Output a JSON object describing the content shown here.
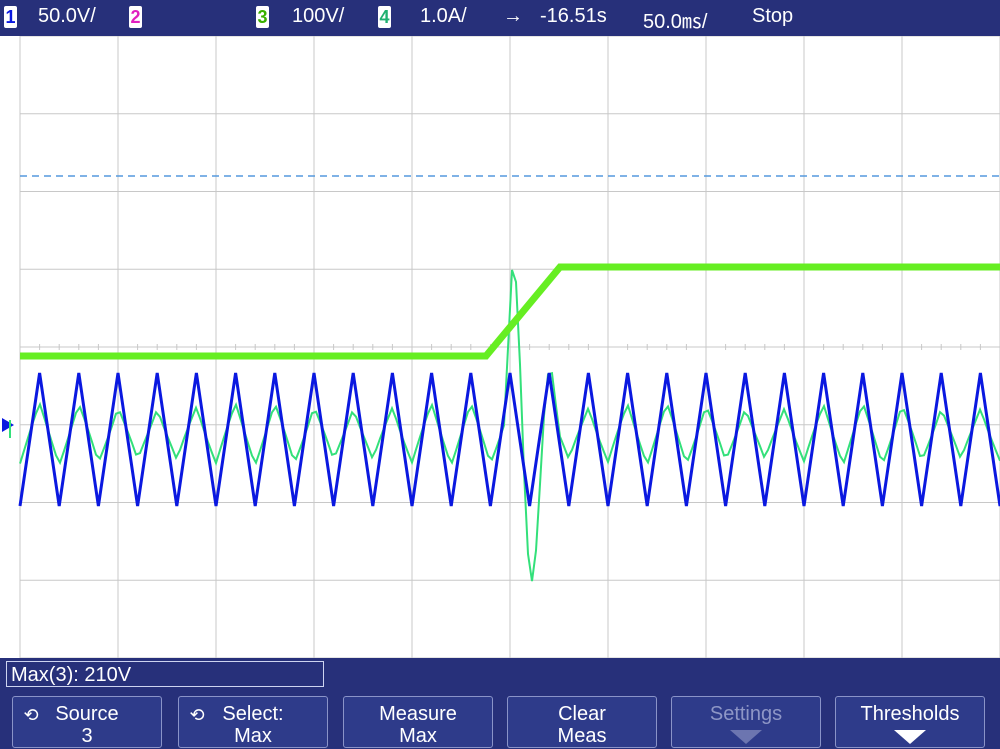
{
  "status_bar": {
    "ch1_num": "1",
    "ch1_scale": "50.0V/",
    "ch2_num": "2",
    "ch3_num": "3",
    "ch3_scale": "100V/",
    "ch4_num": "4",
    "ch4_scale": "1.0A/",
    "trigger_arrow": "→",
    "time_offset": "-16.51s",
    "time_scale": "50.0㎳/",
    "run_state": "Stop"
  },
  "measurement": {
    "readout": "Max(3): 210V"
  },
  "softkeys": [
    {
      "line1": "Source",
      "line2": "3",
      "has_rotate": true,
      "dim": false
    },
    {
      "line1": "Select:",
      "line2": "Max",
      "has_rotate": true,
      "dim": false
    },
    {
      "line1": "Measure",
      "line2": "Max",
      "has_rotate": false,
      "dim": false
    },
    {
      "line1": "Clear",
      "line2": "Meas",
      "has_rotate": false,
      "dim": false
    },
    {
      "line1": "Settings",
      "line2": "",
      "has_rotate": false,
      "dim": true
    },
    {
      "line1": "Thresholds",
      "line2": "",
      "has_rotate": false,
      "dim": false
    }
  ],
  "icons": {
    "rotate": "knob-rotate-icon",
    "arrow": "down-arrow-icon"
  },
  "colors": {
    "ch1": "#0a18e0",
    "ch3": "#66ee22",
    "ch4": "#33e07a",
    "cursor": "#5599dd",
    "grid": "#c8c8c8"
  },
  "chart_data": {
    "type": "line",
    "title": "",
    "x_divisions": 10,
    "y_divisions": 8,
    "series": [
      {
        "name": "",
        "channel": 1,
        "shape": "triangle-wave",
        "cycles": 25
      },
      {
        "name": "",
        "channel": 3,
        "shape": "step",
        "low_level_div": -0.1,
        "high_level_div": 1.1,
        "step_time_div": 5.1
      },
      {
        "name": "",
        "channel": 4,
        "shape": "triangle-wave-with-transient",
        "transient_time_div": 5.2
      }
    ],
    "cursor_level_div": 2.2
  }
}
